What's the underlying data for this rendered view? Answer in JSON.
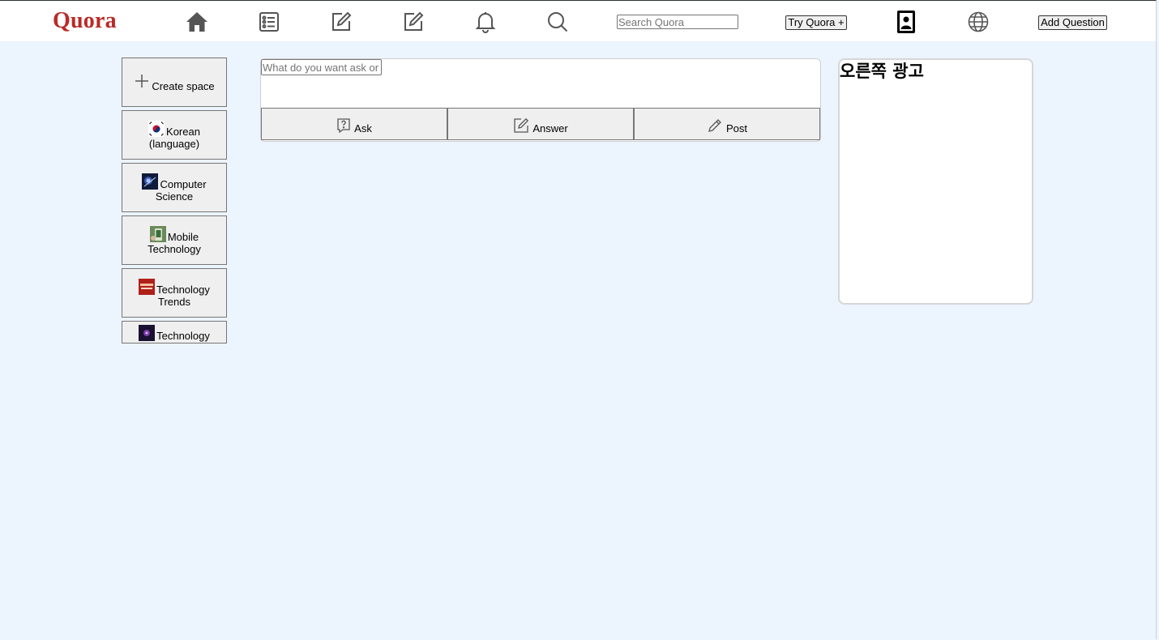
{
  "header": {
    "logo": "Quora",
    "nav_icons": [
      "home-icon",
      "list-icon",
      "edit-icon",
      "edit-icon",
      "bell-icon",
      "search-icon",
      "profile-icon",
      "globe-icon"
    ],
    "search_placeholder": "Search Quora",
    "try_plus_label": "Try Quora +",
    "add_question_label": "Add Question"
  },
  "sidebar": {
    "create_label": "Create space",
    "spaces": [
      {
        "label": "Korean (language)",
        "icon": "korea-flag-icon"
      },
      {
        "label": "Computer Science",
        "icon": "computer-science-thumb"
      },
      {
        "label": "Mobile Technology",
        "icon": "mobile-tech-thumb"
      },
      {
        "label": "Technology Trends",
        "icon": "tech-trends-thumb"
      },
      {
        "label": "Technology",
        "icon": "technology-thumb"
      }
    ]
  },
  "composer": {
    "placeholder": "What do you want ask or share?",
    "ask_label": "Ask",
    "answer_label": "Answer",
    "post_label": "Post"
  },
  "ad": {
    "title": "오른쪽 광고"
  },
  "colors": {
    "brand": "#b92b27",
    "page_bg": "#ecf4fe",
    "button_bg": "#efefef"
  }
}
